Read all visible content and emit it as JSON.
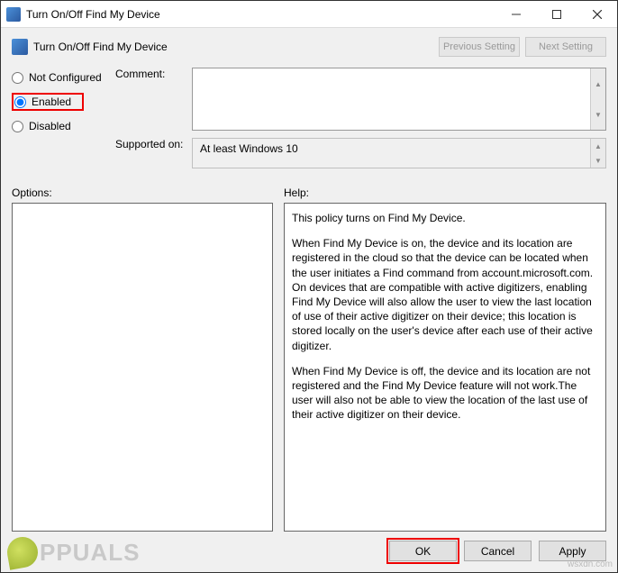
{
  "titlebar": {
    "title": "Turn On/Off Find My Device"
  },
  "header": {
    "title": "Turn On/Off Find My Device"
  },
  "nav": {
    "prev": "Previous Setting",
    "next": "Next Setting"
  },
  "state": {
    "options": {
      "not_configured": "Not Configured",
      "enabled": "Enabled",
      "disabled": "Disabled"
    },
    "selected": "enabled"
  },
  "labels": {
    "comment": "Comment:",
    "supported": "Supported on:",
    "options": "Options:",
    "help": "Help:"
  },
  "comment_value": "",
  "supported_value": "At least Windows 10",
  "options_panel": "",
  "help_panel": {
    "p1": "This policy turns on Find My Device.",
    "p2": "When Find My Device is on, the device and its location are registered in the cloud so that the device can be located when the user initiates a Find command from account.microsoft.com. On devices that are compatible with active digitizers, enabling Find My Device will also allow the user to view the last location of use of their active digitizer on their device; this location is stored locally on the user's device after each use of their active digitizer.",
    "p3": "When Find My Device is off, the device and its location are not registered and the Find My Device feature will not work.The user will also not be able to view the location of the last use of their active digitizer on their device."
  },
  "footer": {
    "ok": "OK",
    "cancel": "Cancel",
    "apply": "Apply"
  },
  "watermark": {
    "brand": "PPUALS",
    "source": "wsxdn.com"
  }
}
